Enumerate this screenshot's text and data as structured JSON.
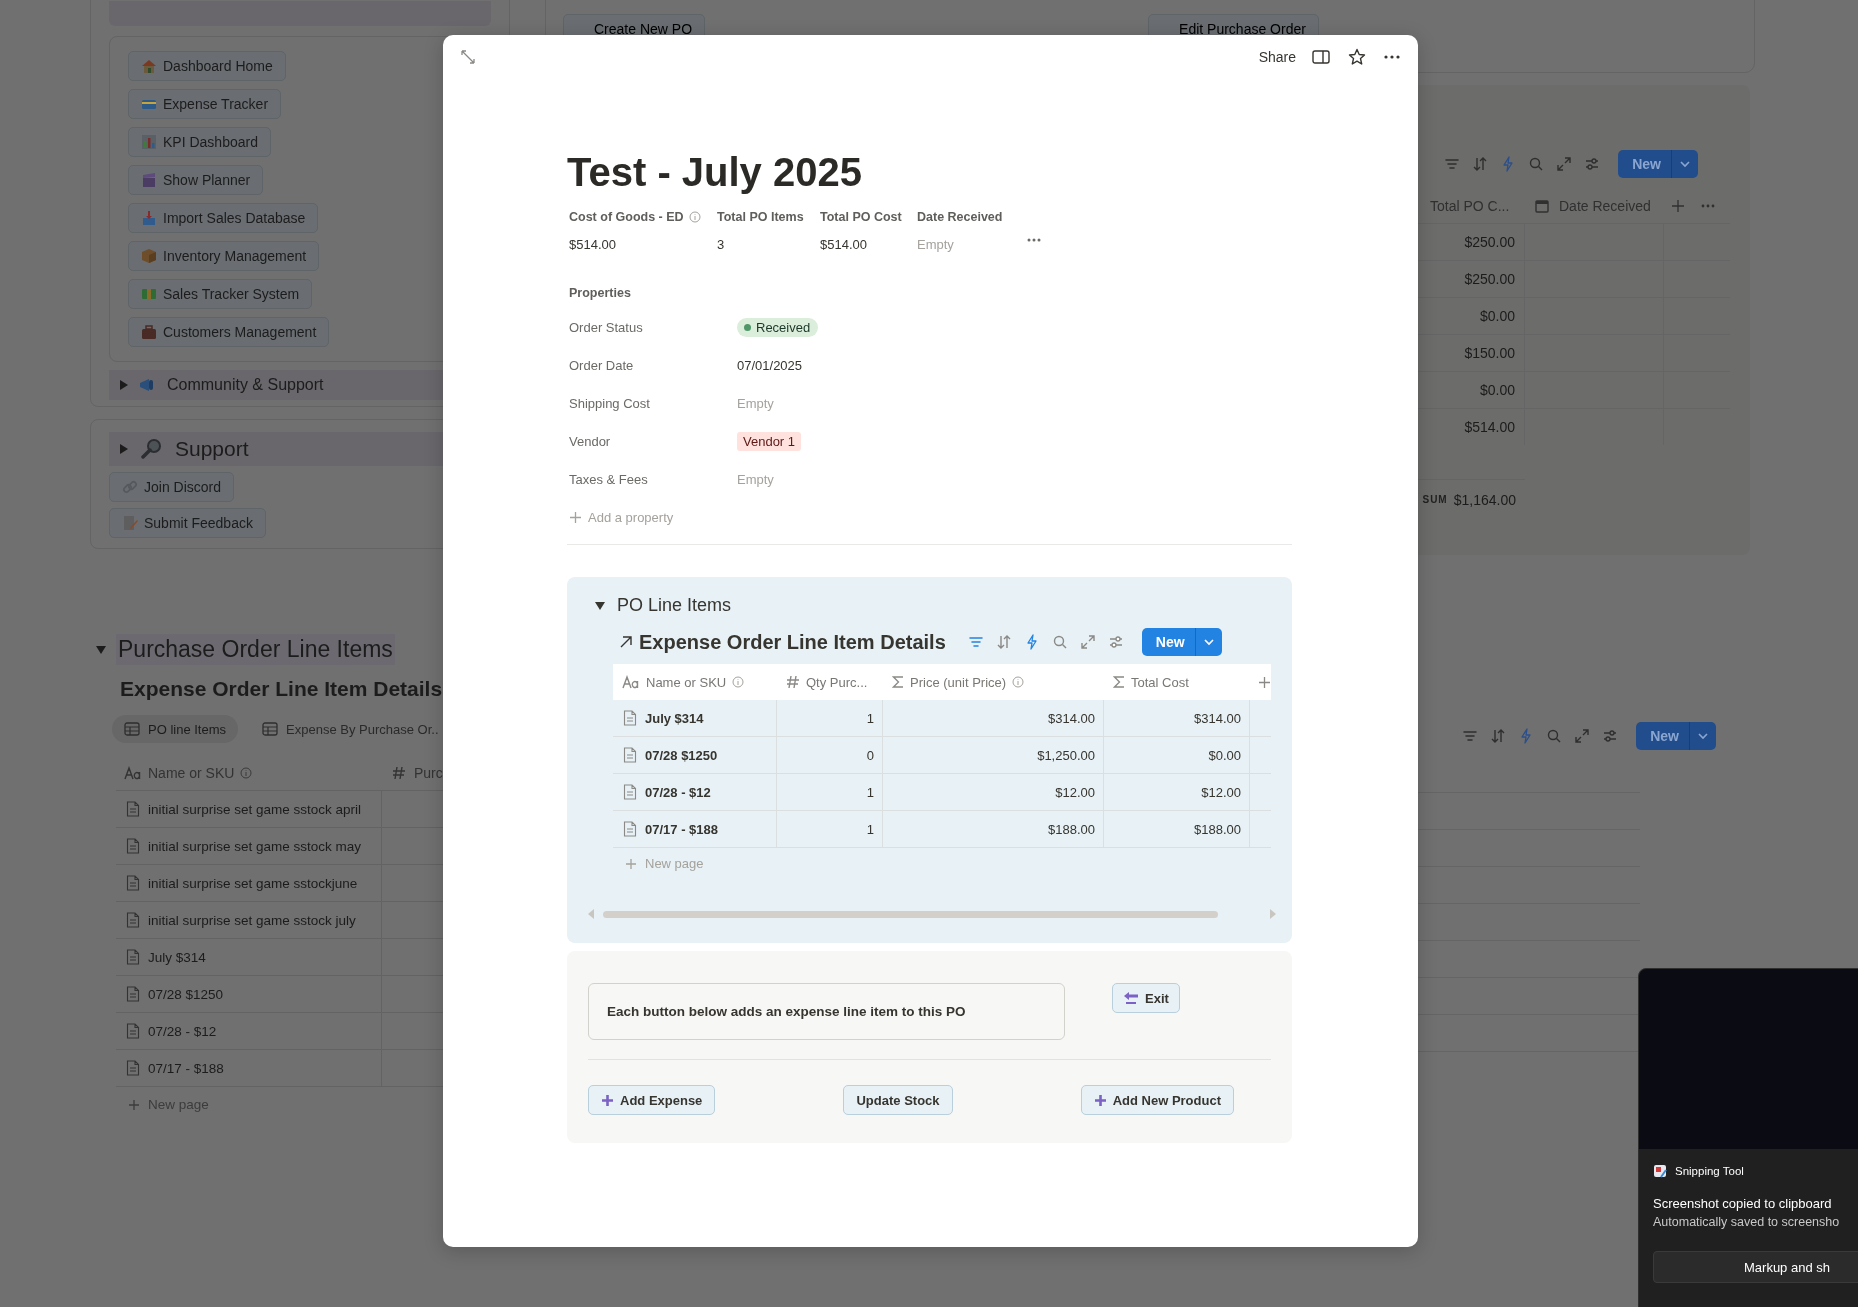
{
  "background": {
    "sidebar": {
      "nav_buttons": [
        {
          "label": "Dashboard Home",
          "kind": "house"
        },
        {
          "label": "Expense Tracker",
          "kind": "card"
        },
        {
          "label": "KPI Dashboard",
          "kind": "chart"
        },
        {
          "label": "Show Planner",
          "kind": "clapper"
        },
        {
          "label": "Import Sales Database",
          "kind": "tray"
        },
        {
          "label": "Inventory Management",
          "kind": "box"
        },
        {
          "label": "Sales Tracker System",
          "kind": "money"
        },
        {
          "label": "Customers Management",
          "kind": "briefcase"
        }
      ],
      "community": {
        "label": "Community & Support",
        "expanded": false
      },
      "support": {
        "title": "Support",
        "expanded": false,
        "buttons": [
          {
            "label": "Join Discord",
            "kind": "link"
          },
          {
            "label": "Submit Feedback",
            "kind": "memo"
          }
        ]
      }
    },
    "top_buttons": [
      "Create New PO",
      "Edit Purchase Order"
    ],
    "orders_table": {
      "new_button": "New",
      "columns": [
        "Total PO C...",
        "Date Received"
      ],
      "rows": [
        "$250.00",
        "$250.00",
        "$0.00",
        "$150.00",
        "$0.00",
        "$514.00"
      ],
      "sum_label": "SUM",
      "sum": "$1,164.00"
    },
    "line_items_section": {
      "title": "Purchase Order Line Items",
      "expanded": true,
      "database_title": "Expense Order Line Item Details",
      "views": [
        {
          "label": "PO line Items",
          "selected": true
        },
        {
          "label": "Expense By Purchase Or..",
          "selected": false
        }
      ],
      "columns": [
        "Name or SKU",
        "Purc"
      ],
      "rows": [
        "initial surprise set game sstock april",
        "initial surprise set game sstock may",
        "initial surprise set game sstockjune",
        "initial surprise set game sstock july",
        "July $314",
        "07/28 $1250",
        "07/28 - $12",
        "07/17 - $188"
      ],
      "new_page": "New page",
      "new_button": "New"
    }
  },
  "modal": {
    "share": "Share",
    "title": "Test - July 2025",
    "summary": [
      {
        "label": "Cost of Goods - ED",
        "info": true,
        "value": "$514.00",
        "empty": false
      },
      {
        "label": "Total PO Items",
        "info": false,
        "value": "3",
        "empty": false
      },
      {
        "label": "Total PO Cost",
        "info": false,
        "value": "$514.00",
        "empty": false
      },
      {
        "label": "Date Received",
        "info": false,
        "value": "Empty",
        "empty": true
      }
    ],
    "properties_heading": "Properties",
    "properties": [
      {
        "label": "Order Status",
        "kind": "status",
        "value": "Received",
        "color": "#4f9768"
      },
      {
        "label": "Order Date",
        "kind": "text",
        "value": "07/01/2025"
      },
      {
        "label": "Shipping Cost",
        "kind": "empty",
        "value": "Empty"
      },
      {
        "label": "Vendor",
        "kind": "tag",
        "value": "Vendor 1"
      },
      {
        "label": "Taxes & Fees",
        "kind": "empty",
        "value": "Empty"
      }
    ],
    "add_property": "Add a property",
    "line_items": {
      "title": "PO Line Items",
      "expanded": true,
      "database_title": "Expense Order Line Item Details",
      "new_button": "New",
      "columns": [
        {
          "label": "Name or SKU",
          "kind": "title",
          "info": true
        },
        {
          "label": "Qty Purc...",
          "kind": "number",
          "info": false
        },
        {
          "label": "Price (unit Price)",
          "kind": "formula",
          "info": true
        },
        {
          "label": "Total Cost",
          "kind": "formula",
          "info": false
        }
      ],
      "rows": [
        {
          "name": "July $314",
          "qty": "1",
          "price": "$314.00",
          "total": "$314.00"
        },
        {
          "name": "07/28 $1250",
          "qty": "0",
          "price": "$1,250.00",
          "total": "$0.00"
        },
        {
          "name": "07/28 - $12",
          "qty": "1",
          "price": "$12.00",
          "total": "$12.00"
        },
        {
          "name": "07/17 - $188",
          "qty": "1",
          "price": "$188.00",
          "total": "$188.00"
        }
      ],
      "new_page": "New page"
    },
    "actions": {
      "callout": "Each button below adds an expense line item to this PO",
      "exit": "Exit",
      "buttons": [
        {
          "label": "Add Expense",
          "plus": true
        },
        {
          "label": "Update Stock",
          "plus": false
        },
        {
          "label": "Add New Product",
          "plus": true
        }
      ]
    }
  },
  "toast": {
    "app": "Snipping Tool",
    "title": "Screenshot copied to clipboard",
    "subtitle": "Automatically saved to screensho",
    "button": "Markup and sh"
  }
}
